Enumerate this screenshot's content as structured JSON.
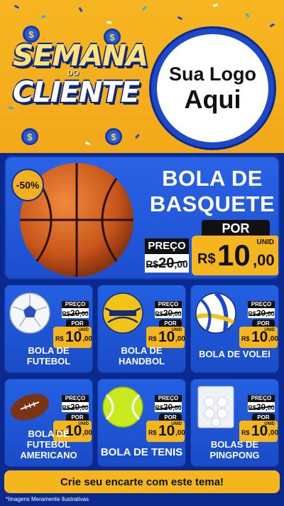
{
  "header": {
    "title_line1": "SEMANA",
    "title_connector": "DO",
    "title_line2": "CLIENTE",
    "logo_line1": "Sua Logo",
    "logo_line2": "Aqui",
    "coin_symbol": "$"
  },
  "hero": {
    "discount_badge": "-50%",
    "title_line1": "BOLA DE",
    "title_line2": "BASQUETE",
    "preco_label": "PREÇO",
    "old_currency": "R$",
    "old_int": "20",
    "old_dec": ",00",
    "por_label": "POR",
    "unid_label": "UNID",
    "currency": "R$",
    "price_int": "10",
    "price_dec": ",00"
  },
  "products": [
    {
      "name": "BOLA DE FUTEBOL",
      "image_icon": "soccer-ball-icon"
    },
    {
      "name": "BOLA DE HANDBOL",
      "image_icon": "handball-icon"
    },
    {
      "name": "BOLA DE VOLEI",
      "image_icon": "volleyball-icon"
    },
    {
      "name": "BOLA DE FUTEBOL AMERICANO",
      "image_icon": "american-football-icon"
    },
    {
      "name": "BOLA DE TENIS",
      "image_icon": "tennis-ball-icon"
    },
    {
      "name": "BOLAS DE PINGPONG",
      "image_icon": "pingpong-balls-icon"
    }
  ],
  "card_price": {
    "preco_label": "PREÇO",
    "old_currency": "R$",
    "old_int": "20",
    "old_dec": ",00",
    "por_label": "POR",
    "unid_label": "UNID",
    "currency": "R$",
    "price_int": "10",
    "price_dec": ",00"
  },
  "footer": {
    "cta": "Crie seu encarte com este tema!",
    "disclaimer": "*Imagens Meramente Ilustrativas"
  },
  "colors": {
    "header_bg": "#f7b621",
    "body_bg": "#0b2a8f",
    "card_bg": "#2360e2",
    "price_bg": "#f5b51d",
    "tag_bg": "#111111"
  }
}
